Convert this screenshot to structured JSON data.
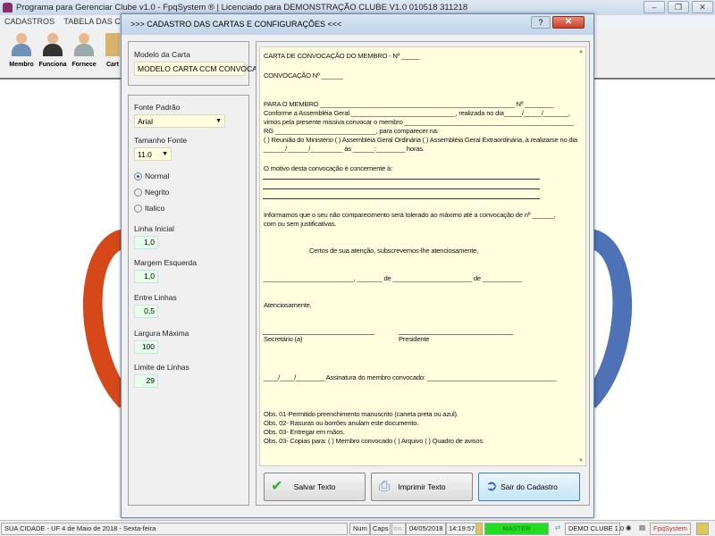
{
  "window": {
    "title": "Programa para Gerenciar Clube v1.0 - FpqSystem ® | Licenciado para  DEMONSTRAÇÃO CLUBE V1.0 010518 311218",
    "minimize": "–",
    "restore": "❐",
    "close": "✕"
  },
  "menu": [
    "CADASTROS",
    "TABELA DAS CONTRIBUIÇ"
  ],
  "toolbar": [
    {
      "label": "Membro"
    },
    {
      "label": "Funciona"
    },
    {
      "label": "Fornece"
    },
    {
      "label": "Cart"
    }
  ],
  "dialog": {
    "title": ">>>  CADASTRO DAS CARTAS E CONFIGURAÇÕES  <<<",
    "help": "?",
    "close": "✕",
    "modelo_label": "Modelo da Carta",
    "modelo_value": "MODELO CARTA CCM CONVOCAÇÃO",
    "fonte_label": "Fonte Padrão",
    "fonte_value": "Arial",
    "tamanho_label": "Tamanho Fonte",
    "tamanho_value": "11.0",
    "styles": [
      {
        "label": "Normal",
        "selected": true
      },
      {
        "label": "Negrito",
        "selected": false
      },
      {
        "label": "Italico",
        "selected": false
      }
    ],
    "fields": [
      {
        "label": "Linha Inicial",
        "value": "1,0"
      },
      {
        "label": "Margem Esquerda",
        "value": "1,0"
      },
      {
        "label": "Entre Linhas",
        "value": "0,5"
      },
      {
        "label": "Largura Máxima",
        "value": "100"
      },
      {
        "label": "Limite de Linhas",
        "value": "29"
      }
    ],
    "letter": [
      "CARTA DE CONVOCAÇÃO DO MEMBRO - Nº _____",
      "CONVOCAÇÃO Nº ______",
      "PARA O MEMBRO ______________________________________________________ Nº ________",
      "       Conforme a Assembléia Geral _____________________________, realizada no dia_____/_____/_______,",
      "vimos pela presente missiva convocar o membro _______________________________________________",
      "RG ____________________________, para comparecer na:",
      "(    ) Reunião do Ministério (    ) Assembléia Geral Ordinária (    ) Assembléia Geral Extraordinária, à  realizarse no dia",
      "______/______/_________ às ______:________ horas.",
      "O motivo desta convocação é concernente à:",
      "Informamos que o seu não comparecimento será tolerado ao máximo até a convocação de nº ______,",
      "com ou sem justificativas.",
      "Certos de sua atenção, subscrevemos-lhe  atenciosamente,",
      "_________________________, _______ de ______________________ de ___________",
      "Atenciosamente,",
      "Secretário (a)",
      "Presidente",
      "____/____/________ Assinatura do membro convocado: ____________________________________",
      "Obs. 01-Permitido preenchimento manuscrito (caneta preta ou azul).",
      "Obs. 02- Rasuras ou borrões anulam este documento.",
      "Obs. 03- Entregar em mãos.",
      "Obs. 03- Copias para: (    ) Membro convocado (    ) Arquivo (    ) Quadro de avisos."
    ],
    "buttons": {
      "save": "Salvar Texto",
      "print": "Imprimir Texto",
      "exit": "Sair do Cadastro"
    }
  },
  "status": {
    "city": "SUA CIDADE - UF  4 de Maio de 2018 - Sexta-feira",
    "num": "Num",
    "caps": "Caps",
    "ins": "Ins",
    "date": "04/05/2018",
    "time": "14:19:57",
    "user": "MASTER",
    "company": "DEMO CLUBE 1.0",
    "brand": "FpqSystem"
  },
  "colors": {
    "memo_bg": "#ffffe0",
    "status_user_bg": "#22dd22",
    "red_arc": "#d64719",
    "blue_arc": "#4f71b6"
  }
}
